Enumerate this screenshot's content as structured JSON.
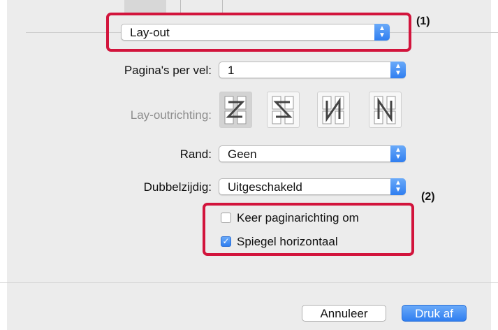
{
  "callouts": {
    "first": "(1)",
    "second": "(2)"
  },
  "section_popup": {
    "value": "Lay-out"
  },
  "pages_per_sheet": {
    "label": "Pagina's per vel:",
    "value": "1"
  },
  "layout_direction": {
    "label": "Lay-outrichting:",
    "options": [
      {
        "icon": "z-direction-icon",
        "selected": true
      },
      {
        "icon": "reverse-z-direction-icon",
        "selected": false
      },
      {
        "icon": "n-reverse-direction-icon",
        "selected": false
      },
      {
        "icon": "n-direction-icon",
        "selected": false
      }
    ]
  },
  "border": {
    "label": "Rand:",
    "value": "Geen"
  },
  "duplex": {
    "label": "Dubbelzijdig:",
    "value": "Uitgeschakeld"
  },
  "checkboxes": [
    {
      "label": "Keer paginarichting om",
      "checked": false
    },
    {
      "label": "Spiegel horizontaal",
      "checked": true
    }
  ],
  "buttons": {
    "cancel": "Annuleer",
    "print": "Druk af"
  },
  "colors": {
    "accent": "#3b82f6",
    "highlight": "#d2143c",
    "panel": "#ececec"
  }
}
